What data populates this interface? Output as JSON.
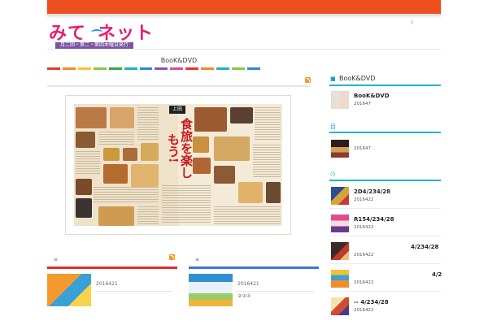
{
  "header": {
    "logo_main_a": "みて",
    "logo_main_b": "ネット",
    "logo_sub": "月二回・第二・第四木曜日発行",
    "corner_mark": "l"
  },
  "page": {
    "title": "BooK&DVD",
    "stripe_colors": [
      "#e8372b",
      "#f1892e",
      "#f7c22b",
      "#8dc63f",
      "#2fa84f",
      "#1fb3b3",
      "#2a8ad4",
      "#8a55b3",
      "#d84b9a",
      "#e8372b",
      "#f1892e",
      "#1fb3b3",
      "#8dc63f",
      "#2a8ad4"
    ]
  },
  "feature": {
    "badge": "上田",
    "headline": "食旅を楽しもう!"
  },
  "subblocks": [
    {
      "hash": "≡",
      "line_color": "#e02d2d",
      "date": "2016421",
      "extra": ""
    },
    {
      "hash": "≡",
      "line_color": "#3a78d1",
      "date": "2016421",
      "extra": "②③③"
    }
  ],
  "sidebar": {
    "sections": [
      {
        "icon": "■",
        "label": "BooK&DVD",
        "items": [
          {
            "title": "BooK&DVD",
            "date": "201647"
          }
        ]
      },
      {
        "icon": "目",
        "label": "",
        "items": [
          {
            "title": "",
            "date": "201647"
          }
        ]
      },
      {
        "icon": "◷",
        "label": "",
        "items": [
          {
            "title": "2D4/234/28",
            "date": "2016422"
          },
          {
            "title": "R154/234/28",
            "date": "2016422"
          },
          {
            "title": "4/234/28",
            "date": "2016422"
          },
          {
            "title": "4/2",
            "date": "2016422"
          },
          {
            "title": "-- 4/234/28",
            "date": "2016422"
          }
        ]
      }
    ]
  }
}
